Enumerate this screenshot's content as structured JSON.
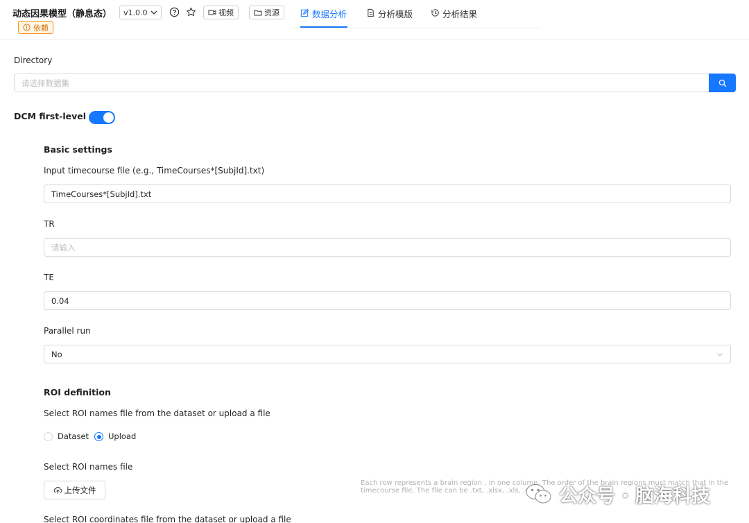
{
  "header": {
    "title": "动态因果模型（静息态）",
    "version": "v1.0.0",
    "video_label": "视频",
    "resource_label": "资源",
    "dependency_label": "依赖",
    "tabs": [
      {
        "label": "数据分析",
        "active": true
      },
      {
        "label": "分析模版",
        "active": false
      },
      {
        "label": "分析结果",
        "active": false
      }
    ]
  },
  "form": {
    "directory_label": "Directory",
    "directory_placeholder": "请选择数据集",
    "dcm_label": "DCM first-level",
    "dcm_enabled": true,
    "basic_settings_title": "Basic settings",
    "timecourse_label": "Input timecourse file (e.g., TimeCourses*[SubjId].txt)",
    "timecourse_value": "TimeCourses*[SubjId].txt",
    "tr_label": "TR",
    "tr_placeholder": "请输入",
    "te_label": "TE",
    "te_value": "0.04",
    "parallel_label": "Parallel run",
    "parallel_value": "No",
    "roi_title": "ROI definition",
    "roi_names_source_label": "Select ROI names file from the dataset or upload a file",
    "radio_dataset": "Dataset",
    "radio_upload": "Upload",
    "selected_source": "Upload",
    "roi_names_file_label": "Select ROI names file",
    "upload_button": "上传文件",
    "help_text": "Each row represents a brain region , in one column. The order of the brain regions must match that in the timecourse file. The file can be .txt, .xlsx, .xls, .csv.",
    "roi_coords_label": "Select ROI coordinates file from the dataset or upload a file"
  },
  "watermark": {
    "text": "公众号 · 脑海科技"
  },
  "colors": {
    "primary": "#1677ff",
    "warning": "#fa8c16"
  }
}
